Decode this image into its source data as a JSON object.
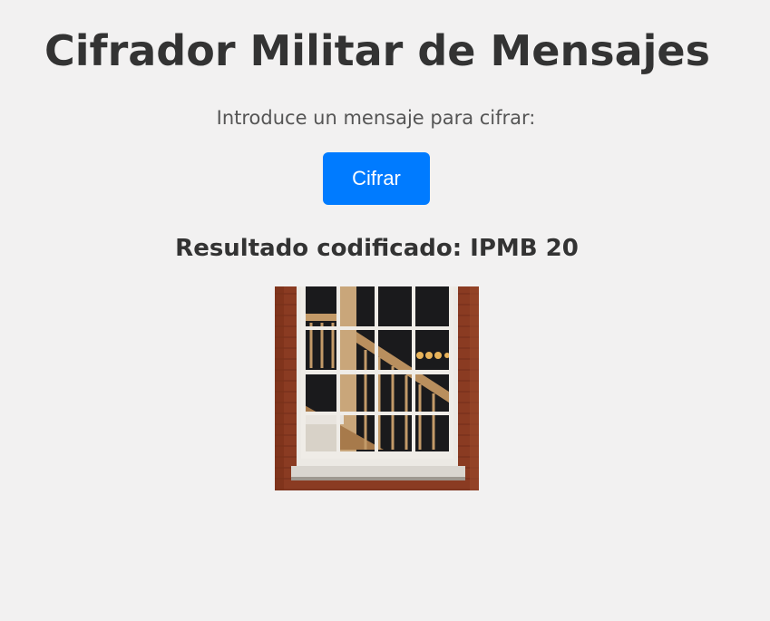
{
  "header": {
    "title": "Cifrador Militar de Mensajes"
  },
  "form": {
    "prompt": "Introduce un mensaje para cifrar:",
    "encrypt_label": "Cifrar"
  },
  "result": {
    "text": "Resultado codificado: IPMB 20"
  },
  "image": {
    "alt": "window-with-staircase-photo"
  },
  "colors": {
    "background": "#f2f1f1",
    "button": "#007bff",
    "title_text": "#333333",
    "prompt_text": "#555555"
  }
}
